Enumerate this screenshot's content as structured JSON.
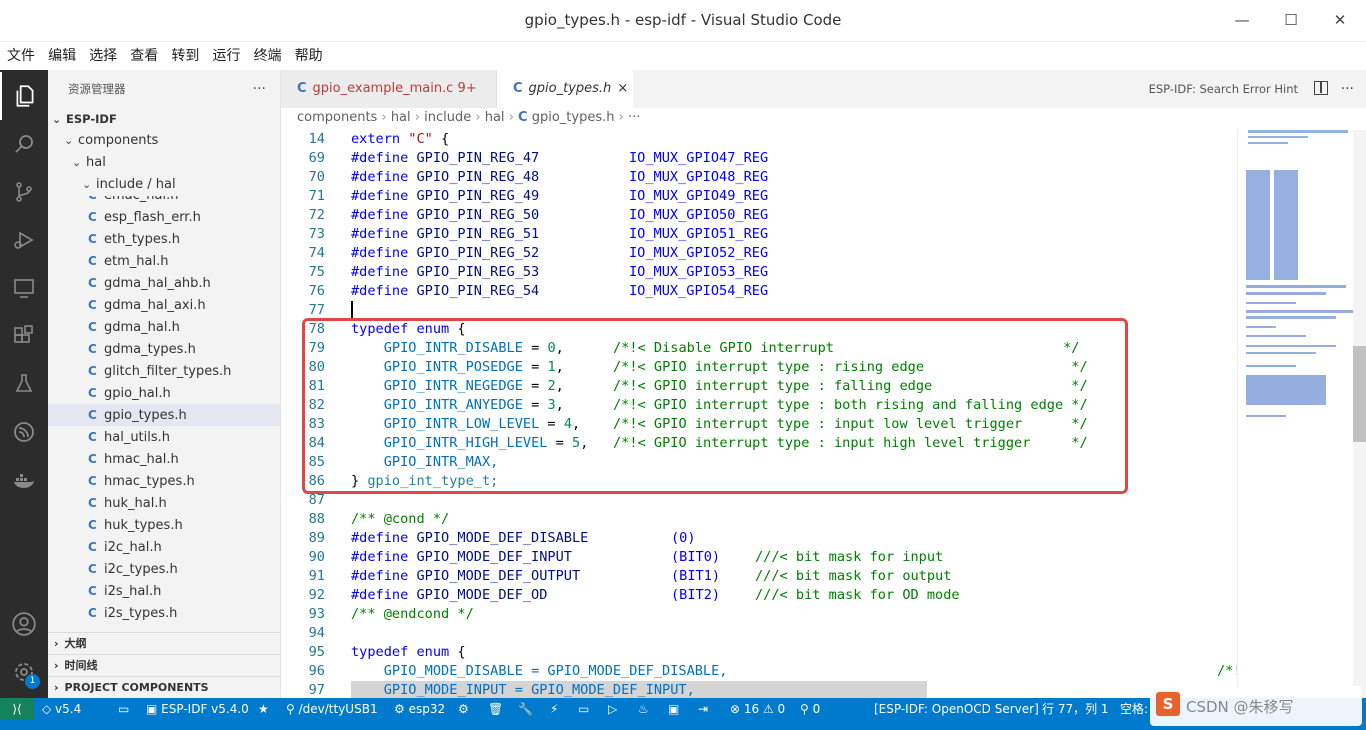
{
  "window": {
    "title": "gpio_types.h - esp-idf - Visual Studio Code"
  },
  "menu": [
    "文件",
    "编辑",
    "选择",
    "查看",
    "转到",
    "运行",
    "终端",
    "帮助"
  ],
  "sidebar": {
    "title": "资源管理器",
    "root": "ESP-IDF",
    "folders": [
      "components",
      "hal",
      "include / hal"
    ],
    "files": [
      "emac_hal.h",
      "esp_flash_err.h",
      "eth_types.h",
      "etm_hal.h",
      "gdma_hal_ahb.h",
      "gdma_hal_axi.h",
      "gdma_hal.h",
      "gdma_types.h",
      "glitch_filter_types.h",
      "gpio_hal.h",
      "gpio_types.h",
      "hal_utils.h",
      "hmac_hal.h",
      "hmac_types.h",
      "huk_hal.h",
      "huk_types.h",
      "i2c_hal.h",
      "i2c_types.h",
      "i2s_hal.h",
      "i2s_types.h"
    ],
    "selected_file": "gpio_types.h",
    "sections": [
      "大纲",
      "时间线",
      "PROJECT COMPONENTS"
    ]
  },
  "tabs": [
    {
      "icon": "C",
      "label": "gpio_example_main.c",
      "badge": "9+"
    },
    {
      "icon": "C",
      "label": "gpio_types.h",
      "close": "×"
    }
  ],
  "search_hint": "ESP-IDF: Search Error Hint",
  "breadcrumb": [
    "components",
    "hal",
    "include",
    "hal",
    "C",
    "gpio_types.h",
    "···"
  ],
  "editor": {
    "sticky": {
      "n": "14",
      "text": "extern \"C\" {"
    },
    "gpio_defines": [
      {
        "n": "69",
        "name": "GPIO_PIN_REG_47",
        "val": "IO_MUX_GPIO47_REG"
      },
      {
        "n": "70",
        "name": "GPIO_PIN_REG_48",
        "val": "IO_MUX_GPIO48_REG"
      },
      {
        "n": "71",
        "name": "GPIO_PIN_REG_49",
        "val": "IO_MUX_GPIO49_REG"
      },
      {
        "n": "72",
        "name": "GPIO_PIN_REG_50",
        "val": "IO_MUX_GPIO50_REG"
      },
      {
        "n": "73",
        "name": "GPIO_PIN_REG_51",
        "val": "IO_MUX_GPIO51_REG"
      },
      {
        "n": "74",
        "name": "GPIO_PIN_REG_52",
        "val": "IO_MUX_GPIO52_REG"
      },
      {
        "n": "75",
        "name": "GPIO_PIN_REG_53",
        "val": "IO_MUX_GPIO53_REG"
      },
      {
        "n": "76",
        "name": "GPIO_PIN_REG_54",
        "val": "IO_MUX_GPIO54_REG"
      }
    ],
    "blank77": "77",
    "enum_open": {
      "n": "78",
      "text": "typedef enum {"
    },
    "enum_items": [
      {
        "n": "79",
        "name": "GPIO_INTR_DISABLE",
        "val": "0",
        "comment": "/*!< Disable GPIO interrupt                            */"
      },
      {
        "n": "80",
        "name": "GPIO_INTR_POSEDGE",
        "val": "1",
        "comment": "/*!< GPIO interrupt type : rising edge                  */"
      },
      {
        "n": "81",
        "name": "GPIO_INTR_NEGEDGE",
        "val": "2",
        "comment": "/*!< GPIO interrupt type : falling edge                 */"
      },
      {
        "n": "82",
        "name": "GPIO_INTR_ANYEDGE",
        "val": "3",
        "comment": "/*!< GPIO interrupt type : both rising and falling edge */"
      },
      {
        "n": "83",
        "name": "GPIO_INTR_LOW_LEVEL",
        "val": "4",
        "comment": "/*!< GPIO interrupt type : input low level trigger      */"
      },
      {
        "n": "84",
        "name": "GPIO_INTR_HIGH_LEVEL",
        "val": "5",
        "comment": "/*!< GPIO interrupt type : input high level trigger     */"
      }
    ],
    "enum_max": {
      "n": "85",
      "text": "GPIO_INTR_MAX,"
    },
    "enum_close": {
      "n": "86",
      "text": "gpio_int_type_t;"
    },
    "blank87": "87",
    "cond": {
      "n": "88",
      "text": "/** @cond */"
    },
    "mode_defines": [
      {
        "n": "89",
        "name": "GPIO_MODE_DEF_DISABLE",
        "val": "(0)",
        "comment": ""
      },
      {
        "n": "90",
        "name": "GPIO_MODE_DEF_INPUT",
        "val": "(BIT0)",
        "comment": "///< bit mask for input"
      },
      {
        "n": "91",
        "name": "GPIO_MODE_DEF_OUTPUT",
        "val": "(BIT1)",
        "comment": "///< bit mask for output"
      },
      {
        "n": "92",
        "name": "GPIO_MODE_DEF_OD",
        "val": "(BIT2)",
        "comment": "///< bit mask for OD mode"
      }
    ],
    "endcond": {
      "n": "93",
      "text": "/** @endcond */"
    },
    "blank94": "94",
    "enum2_open": {
      "n": "95",
      "text": "typedef enum {"
    },
    "mode_items": [
      {
        "n": "96",
        "text": "GPIO_MODE_DISABLE = GPIO_MODE_DEF_DISABLE,",
        "comment": "/*!"
      },
      {
        "n": "97",
        "text": "GPIO_MODE_INPUT = GPIO_MODE_DEF_INPUT,",
        "comment": ""
      }
    ]
  },
  "status": {
    "branch": "v5.4",
    "idf": "ESP-IDF v5.4.0",
    "port": "/dev/ttyUSB1",
    "target": "esp32",
    "errors": "16",
    "warnings": "0",
    "ports": "0",
    "openocd": "[ESP-IDF: OpenOCD Server]",
    "position": "行 77，列 1",
    "spaces": "空格:",
    "activity_badge": "1"
  },
  "watermark": "CSDN @朱移写"
}
